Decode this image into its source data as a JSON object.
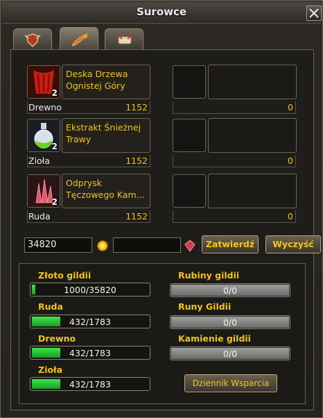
{
  "window": {
    "title": "Surowce"
  },
  "tabs": [
    {
      "icon": "crest-icon"
    },
    {
      "icon": "feather-quill-icon"
    },
    {
      "icon": "scroll-icon"
    }
  ],
  "resources": [
    {
      "name": "Deska Drzewa Ognistej Góry",
      "category": "Drewno",
      "owned": "1152",
      "quantity_badge": "2",
      "right_value": "0",
      "icon": "fire-wood-icon"
    },
    {
      "name": "Ekstrakt Śnieżnej Trawy",
      "category": "Zioła",
      "owned": "1152",
      "quantity_badge": "2",
      "right_value": "0",
      "icon": "potion-flask-icon"
    },
    {
      "name": "Odprysk Tęczowego Kam...",
      "category": "Ruda",
      "owned": "1152",
      "quantity_badge": "2",
      "right_value": "0",
      "icon": "crystal-shard-icon"
    }
  ],
  "donation": {
    "gold_value": "34820",
    "ruby_value": "",
    "confirm_label": "Zatwierdź",
    "clear_label": "Wyczyść"
  },
  "guild": {
    "gold": {
      "label": "Złoto gildii",
      "text": "1000/35820",
      "fraction": 0.028
    },
    "ore": {
      "label": "Ruda",
      "text": "432/1783",
      "fraction": 0.242
    },
    "wood": {
      "label": "Drewno",
      "text": "432/1783",
      "fraction": 0.242
    },
    "herbs": {
      "label": "Zioła",
      "text": "432/1783",
      "fraction": 0.242
    },
    "rubies": {
      "label": "Rubiny gildii",
      "text": "0/0",
      "fraction": 1
    },
    "runes": {
      "label": "Runy Gildii",
      "text": "0/0",
      "fraction": 1
    },
    "stones": {
      "label": "Kamienie gildii",
      "text": "0/0",
      "fraction": 1
    },
    "log_button": "Dziennik Wsparcia"
  },
  "colors": {
    "accent": "#f0c419",
    "progress_green": "#2ec23a",
    "progress_gray": "#8a8a8a"
  }
}
